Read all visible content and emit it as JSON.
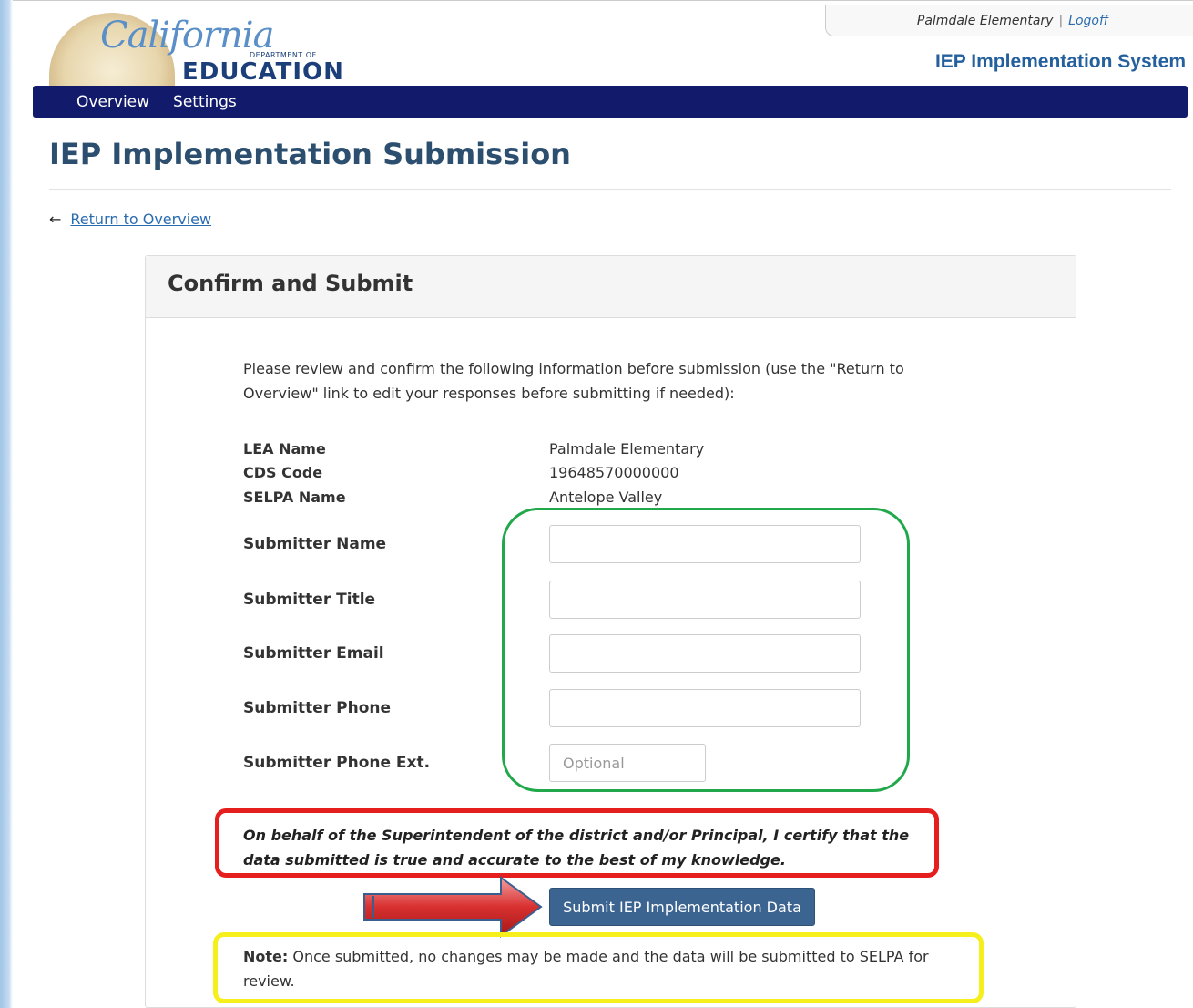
{
  "header": {
    "user_name": "Palmdale Elementary",
    "separator": "|",
    "logoff_label": "Logoff",
    "logo_california": "California",
    "logo_department": "DEPARTMENT OF",
    "logo_education": "EDUCATION",
    "system_title": "IEP Implementation System"
  },
  "nav": {
    "items": [
      {
        "label": "Overview"
      },
      {
        "label": "Settings"
      }
    ]
  },
  "page": {
    "title": "IEP Implementation Submission",
    "return_link": "Return to Overview"
  },
  "panel": {
    "title": "Confirm and Submit",
    "intro": "Please review and confirm the following information before submission (use the \"Return to Overview\" link to edit your responses before submitting if needed):",
    "info": [
      {
        "label": "LEA Name",
        "value": "Palmdale Elementary"
      },
      {
        "label": "CDS Code",
        "value": "19648570000000"
      },
      {
        "label": "SELPA Name",
        "value": "Antelope Valley"
      }
    ],
    "fields": [
      {
        "label": "Submitter Name",
        "value": "",
        "placeholder": ""
      },
      {
        "label": "Submitter Title",
        "value": "",
        "placeholder": ""
      },
      {
        "label": "Submitter Email",
        "value": "",
        "placeholder": ""
      },
      {
        "label": "Submitter Phone",
        "value": "",
        "placeholder": ""
      },
      {
        "label": "Submitter Phone Ext.",
        "value": "",
        "placeholder": "Optional"
      }
    ],
    "certification": "On behalf of the Superintendent of the district and/or Principal, I certify that the data submitted is true and accurate to the best of my knowledge.",
    "submit_label": "Submit IEP Implementation Data",
    "note_label": "Note:",
    "note_text": " Once submitted, no changes may be made and the data will be submitted to SELPA for review."
  },
  "annotations": {
    "green_color": "#21a84b",
    "red_color": "#e51e1e",
    "yellow_color": "#f5ef1b"
  }
}
